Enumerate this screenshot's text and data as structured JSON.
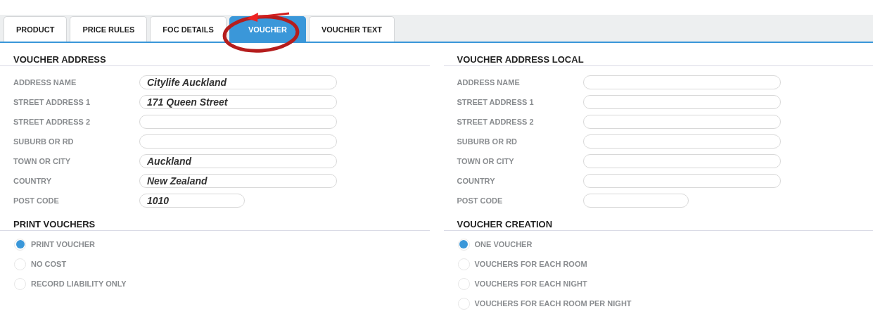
{
  "tabs": [
    {
      "label": "PRODUCT",
      "selected": false
    },
    {
      "label": "PRICE RULES",
      "selected": false
    },
    {
      "label": "FOC DETAILS",
      "selected": false
    },
    {
      "label": "VOUCHER",
      "selected": true,
      "circled": true
    },
    {
      "label": "VOUCHER TEXT",
      "selected": false
    }
  ],
  "columns": [
    {
      "sections": [
        {
          "kind": "fields",
          "title": "VOUCHER ADDRESS",
          "fields": [
            {
              "label": "ADDRESS NAME",
              "kind": "long",
              "value": "Citylife Auckland"
            },
            {
              "label": "STREET ADDRESS 1",
              "kind": "long",
              "value": "171 Queen Street"
            },
            {
              "label": "STREET ADDRESS 2",
              "kind": "long"
            },
            {
              "label": "SUBURB OR RD",
              "kind": "long"
            },
            {
              "label": "TOWN OR CITY",
              "kind": "long",
              "value": "Auckland"
            },
            {
              "label": "COUNTRY",
              "kind": "long",
              "value": "New Zealand"
            },
            {
              "label": "POST CODE",
              "kind": "short",
              "value": "1010"
            }
          ]
        },
        {
          "kind": "radios",
          "title": "PRINT VOUCHERS",
          "options": [
            {
              "label": "PRINT VOUCHER",
              "selected": true
            },
            {
              "label": "NO COST",
              "selected": false
            },
            {
              "label": "RECORD LIABILITY ONLY",
              "selected": false
            }
          ]
        }
      ]
    },
    {
      "sections": [
        {
          "kind": "fields",
          "title": "VOUCHER ADDRESS LOCAL",
          "fields": [
            {
              "label": "ADDRESS NAME",
              "kind": "long"
            },
            {
              "label": "STREET ADDRESS 1",
              "kind": "long"
            },
            {
              "label": "STREET ADDRESS 2",
              "kind": "long"
            },
            {
              "label": "SUBURB OR RD",
              "kind": "long"
            },
            {
              "label": "TOWN OR CITY",
              "kind": "long"
            },
            {
              "label": "COUNTRY",
              "kind": "long"
            },
            {
              "label": "POST CODE",
              "kind": "short"
            }
          ]
        },
        {
          "kind": "radios",
          "title": "VOUCHER CREATION",
          "options": [
            {
              "label": "ONE VOUCHER",
              "selected": true
            },
            {
              "label": "VOUCHERS FOR EACH ROOM",
              "selected": false
            },
            {
              "label": "VOUCHERS FOR EACH NIGHT",
              "selected": false
            },
            {
              "label": "VOUCHERS FOR EACH ROOM PER NIGHT",
              "selected": false
            }
          ]
        }
      ]
    }
  ]
}
